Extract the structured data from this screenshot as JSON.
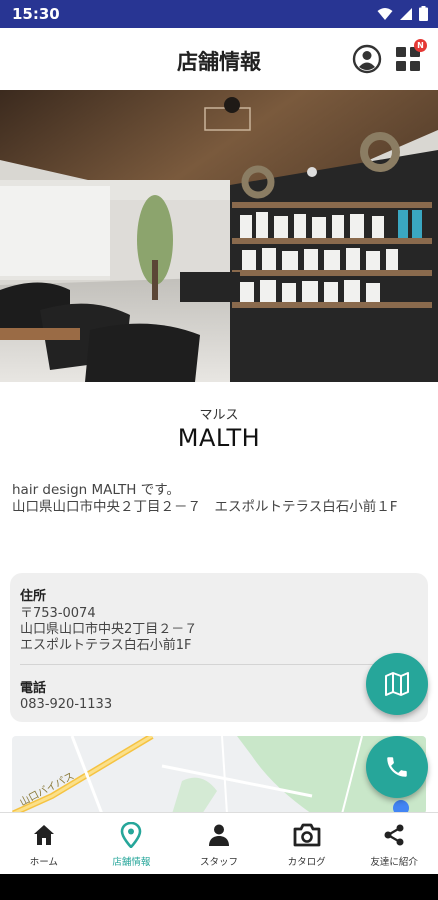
{
  "status_bar": {
    "time": "15:30"
  },
  "header": {
    "title": "店舗情報"
  },
  "notification_badge": "N",
  "store": {
    "kana": "マルス",
    "name": "MALTH",
    "description": "hair design MALTH です。\n山口県山口市中央２丁目２－７　エスポルトテラス白石小前１F"
  },
  "info": {
    "address_label": "住所",
    "address": "〒753-0074\n山口県山口市中央2丁目２－７\nエスポルトテラス白石小前1F",
    "phone_label": "電話",
    "phone": "083-920-1133"
  },
  "map": {
    "road_label": "山口バイパス"
  },
  "colors": {
    "accent": "#26a69a",
    "status_bar": "#283593",
    "badge": "#e53935"
  },
  "nav": [
    {
      "label": "ホーム",
      "icon": "home-icon"
    },
    {
      "label": "店舗情報",
      "icon": "location-pin-icon"
    },
    {
      "label": "スタッフ",
      "icon": "person-icon"
    },
    {
      "label": "カタログ",
      "icon": "camera-icon"
    },
    {
      "label": "友達に紹介",
      "icon": "share-icon"
    }
  ],
  "active_nav_index": 1
}
